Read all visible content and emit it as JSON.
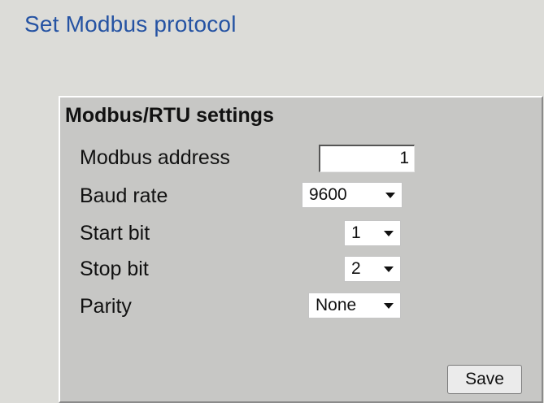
{
  "page": {
    "title": "Set Modbus protocol"
  },
  "panel": {
    "title": "Modbus/RTU settings",
    "rows": [
      {
        "label": "Modbus address",
        "control": "text",
        "value": "1"
      },
      {
        "label": "Baud rate",
        "control": "select",
        "value": "9600"
      },
      {
        "label": "Start bit",
        "control": "select",
        "value": "1"
      },
      {
        "label": "Stop bit",
        "control": "select",
        "value": "2"
      },
      {
        "label": "Parity",
        "control": "select",
        "value": "None"
      }
    ],
    "save_label": "Save"
  },
  "colors": {
    "title_blue": "#2553a3",
    "background": "#dcdcd8",
    "panel": "#c7c7c5"
  },
  "icons": {
    "dropdown": "chevron-down-icon"
  }
}
